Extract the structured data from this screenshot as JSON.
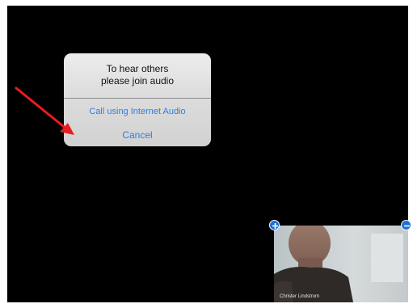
{
  "dialog": {
    "message_line1": "To hear others",
    "message_line2": "please join audio",
    "call_internet_audio_label": "Call using Internet Audio",
    "cancel_label": "Cancel"
  },
  "video": {
    "participant_name": "Christer Lindstrom"
  },
  "icons": {
    "expand": "plus-icon",
    "collapse": "minus-icon",
    "annotation": "red-arrow-annotation"
  },
  "colors": {
    "background": "#000000",
    "dialog_bg": "#dcdcdc",
    "button_text": "#2d7fe0",
    "corner_button": "#1d6fd6",
    "arrow": "#e81c1c"
  }
}
